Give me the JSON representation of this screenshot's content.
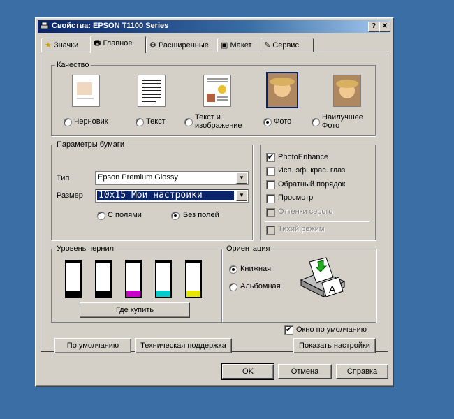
{
  "window": {
    "title": "Свойства: EPSON T1100 Series",
    "help_btn": "?",
    "close_btn": "✕"
  },
  "tabs": [
    {
      "label": "Значки",
      "icon": "star-icon"
    },
    {
      "label": "Главное",
      "icon": "printer-icon"
    },
    {
      "label": "Расширенные",
      "icon": "gear-icon"
    },
    {
      "label": "Макет",
      "icon": "layout-icon"
    },
    {
      "label": "Сервис",
      "icon": "wrench-icon"
    }
  ],
  "quality": {
    "title": "Качество",
    "options": [
      {
        "label": "Черновик",
        "selected": false
      },
      {
        "label": "Текст",
        "selected": false
      },
      {
        "label": "Текст и\nизображение",
        "selected": false
      },
      {
        "label": "Фото",
        "selected": true
      },
      {
        "label": "Наилучшее\nФото",
        "selected": false
      }
    ]
  },
  "paper": {
    "title": "Параметры бумаги",
    "type_label": "Тип",
    "type_value": "Epson Premium Glossy",
    "size_label": "Размер",
    "size_value": "10x15  Мои настройки",
    "margins_label": "С полями",
    "borderless_label": "Без полей",
    "borderless_selected": true
  },
  "options": {
    "photo_enhance": {
      "label": "PhotoEnhance",
      "checked": true
    },
    "redeye": {
      "label": "Исп. эф. крас. глаз",
      "checked": false
    },
    "reverse": {
      "label": "Обратный порядок",
      "checked": false
    },
    "preview": {
      "label": "Просмотр",
      "checked": false
    },
    "grayscale": {
      "label": "Оттенки серого",
      "checked": false
    },
    "quiet": {
      "label": "Тихий режим",
      "checked": false
    }
  },
  "ink": {
    "title": "Уровень чернил",
    "colors": [
      "#000000",
      "#000000",
      "#cc00cc",
      "#00cccc",
      "#e6e600"
    ],
    "buy_label": "Где купить"
  },
  "orientation": {
    "title": "Ориентация",
    "portrait_label": "Книжная",
    "landscape_label": "Альбомная",
    "portrait_selected": true
  },
  "default_window": {
    "label": "Окно по умолчанию",
    "checked": true
  },
  "buttons": {
    "defaults": "По умолчанию",
    "support": "Техническая поддержка",
    "show_settings": "Показать настройки",
    "ok": "OK",
    "cancel": "Отмена",
    "help": "Справка"
  },
  "colors": {
    "title_bar": "#0a246a",
    "annotation_arrow": "#ee1111",
    "selection": "#0a246a"
  }
}
